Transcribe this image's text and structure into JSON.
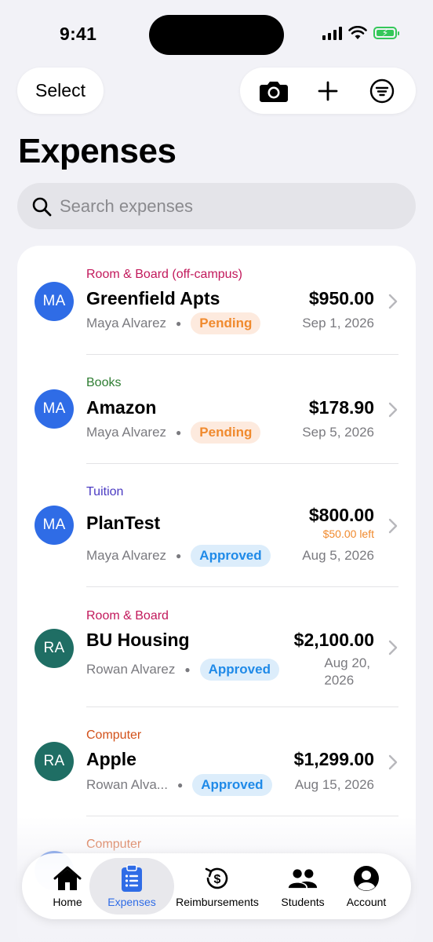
{
  "status_bar": {
    "time": "9:41"
  },
  "header": {
    "select_label": "Select",
    "title": "Expenses",
    "actions": [
      "camera-icon",
      "plus-icon",
      "filter-icon"
    ]
  },
  "search": {
    "placeholder": "Search expenses"
  },
  "colors": {
    "accent": "#2f6ce6",
    "pending_text": "#f08a2e",
    "approved_text": "#1f8ae8",
    "avatar_ma": "#2f6ce6",
    "avatar_ra": "#1f6e64"
  },
  "expenses": [
    {
      "category": "Room & Board (off-campus)",
      "category_color": "#c2185b",
      "initials": "MA",
      "merchant": "Greenfield Apts",
      "person": "Maya Alvarez",
      "status": "Pending",
      "amount": "$950.00",
      "date": "Sep 1, 2026"
    },
    {
      "category": "Books",
      "category_color": "#2e7d32",
      "initials": "MA",
      "merchant": "Amazon",
      "person": "Maya Alvarez",
      "status": "Pending",
      "amount": "$178.90",
      "date": "Sep 5, 2026"
    },
    {
      "category": "Tuition",
      "category_color": "#4a3ac2",
      "initials": "MA",
      "merchant": "PlanTest",
      "person": "Maya Alvarez",
      "status": "Approved",
      "amount": "$800.00",
      "remaining": "$50.00 left",
      "date": "Aug 5, 2026"
    },
    {
      "category": "Room & Board",
      "category_color": "#c2185b",
      "initials": "RA",
      "merchant": "BU Housing",
      "person": "Rowan Alvarez",
      "status": "Approved",
      "amount": "$2,100.00",
      "date_line1": "Aug 20,",
      "date_line2": "2026"
    },
    {
      "category": "Computer",
      "category_color": "#d2511a",
      "initials": "RA",
      "merchant": "Apple",
      "person": "Rowan Alva...",
      "status": "Approved",
      "amount": "$1,299.00",
      "date": "Aug 15, 2026"
    },
    {
      "category": "Computer",
      "category_color": "#d2511a"
    }
  ],
  "tabbar": {
    "items": [
      {
        "label": "Home",
        "icon": "house-icon"
      },
      {
        "label": "Expenses",
        "icon": "clipboard-icon",
        "active": true
      },
      {
        "label": "Reimbursements",
        "icon": "dollar-refresh-icon"
      },
      {
        "label": "Students",
        "icon": "people-icon"
      },
      {
        "label": "Account",
        "icon": "person-circle-icon"
      }
    ]
  }
}
